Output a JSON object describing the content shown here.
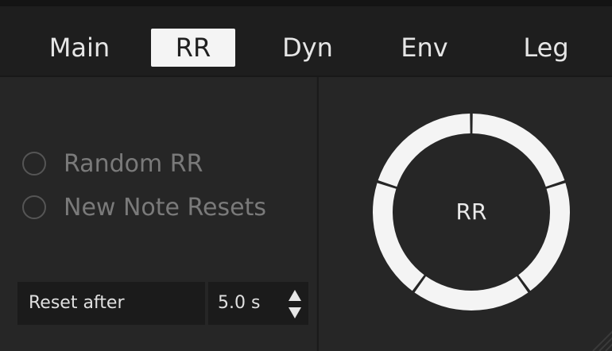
{
  "tabs": [
    {
      "label": "Main",
      "active": false
    },
    {
      "label": "RR",
      "active": true
    },
    {
      "label": "Dyn",
      "active": false
    },
    {
      "label": "Env",
      "active": false
    },
    {
      "label": "Leg",
      "active": false
    }
  ],
  "options": {
    "random_rr": {
      "label": "Random RR",
      "checked": false
    },
    "new_note_resets": {
      "label": "New Note Resets",
      "checked": false
    }
  },
  "reset": {
    "label": "Reset after",
    "value": "5.0 s"
  },
  "rr_display": {
    "label": "RR",
    "segment_count": 5
  },
  "colors": {
    "accent": "#f4f4f4",
    "background": "#262626",
    "muted_text": "#7a7a7a"
  }
}
